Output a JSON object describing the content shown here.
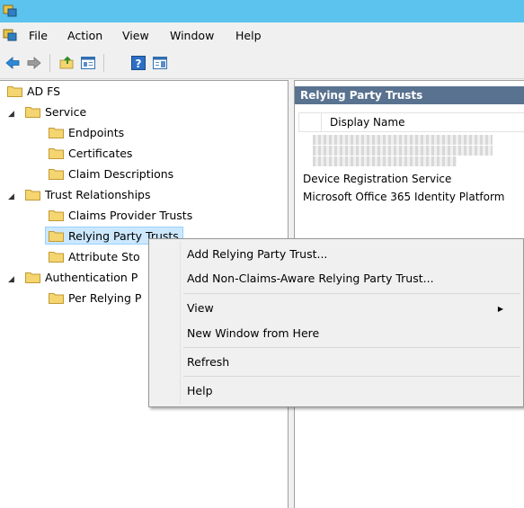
{
  "menubar": {
    "items": [
      "File",
      "Action",
      "View",
      "Window",
      "Help"
    ]
  },
  "tree": {
    "root": "AD FS",
    "service": "Service",
    "endpoints": "Endpoints",
    "certificates": "Certificates",
    "claim_descriptions": "Claim Descriptions",
    "trust_relationships": "Trust Relationships",
    "claims_provider_trusts": "Claims Provider Trusts",
    "relying_party_trusts": "Relying Party Trusts",
    "attribute_stores": "Attribute Sto",
    "authentication_policies": "Authentication P",
    "per_relying_party": "Per Relying P"
  },
  "right_pane": {
    "header": "Relying Party Trusts",
    "column": "Display Name",
    "rows": [
      "Device Registration Service",
      "Microsoft Office 365 Identity Platform"
    ]
  },
  "context_menu": {
    "add_rp_trust": "Add Relying Party Trust...",
    "add_non_claims": "Add Non-Claims-Aware Relying Party Trust...",
    "view": "View",
    "new_window": "New Window from Here",
    "refresh": "Refresh",
    "help": "Help"
  },
  "colors": {
    "titlebar": "#5bc3ed",
    "pane_header": "#59728f",
    "selection": "#cce8ff",
    "folder": "#f4d56f"
  },
  "icons": [
    "mmc-app-icon",
    "back-arrow-icon",
    "forward-arrow-icon",
    "up-folder-icon",
    "show-hide-tree-icon",
    "help-icon",
    "action-pane-icon",
    "folder-icon"
  ]
}
